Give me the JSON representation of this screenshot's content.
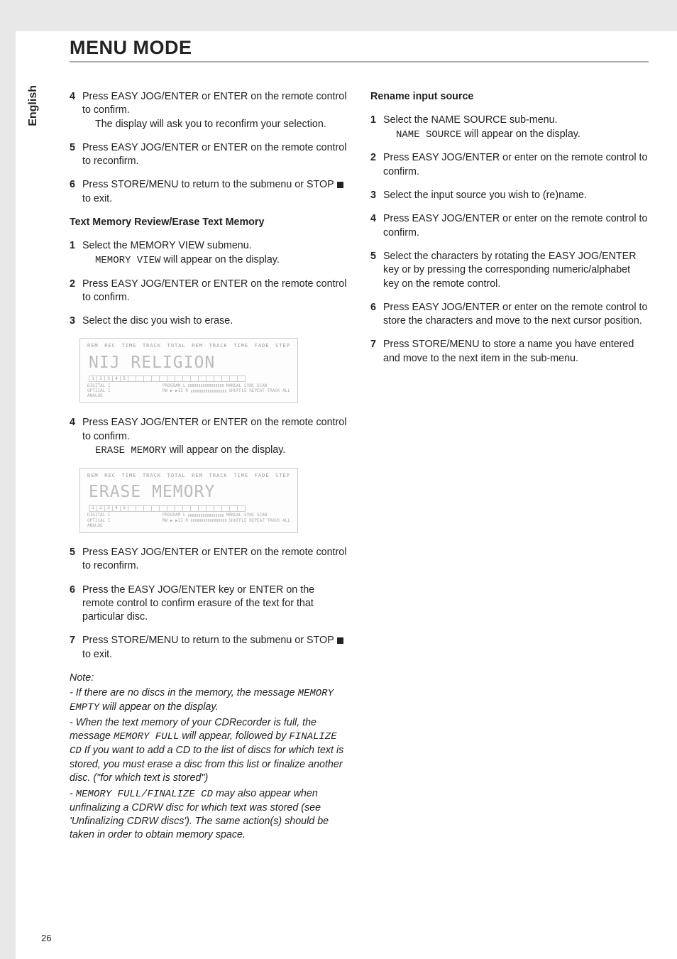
{
  "title": "MENU MODE",
  "language_tab": "English",
  "page_number": "26",
  "left": {
    "s4a": "Press EASY JOG/ENTER or ENTER on the remote control to confirm.",
    "s4b": "The display will ask you to reconfirm your selection.",
    "s5": "Press EASY JOG/ENTER or ENTER on the remote control to reconfirm.",
    "s6a": "Press STORE/MENU to return to the submenu or STOP",
    "s6b": "to exit.",
    "h1": "Text Memory Review/Erase Text Memory",
    "t1a": "Select the MEMORY VIEW submenu.",
    "t1_seg": "MEMORY VIEW",
    "t1b": " will appear on the display.",
    "t2": "Press EASY JOG/ENTER or ENTER on the remote control to confirm.",
    "t3": "Select the disc you wish to erase.",
    "disp1": {
      "top": [
        "REM",
        "REC",
        "TIME",
        "TRACK",
        "",
        "TOTAL",
        "REM",
        "TRACK",
        "TIME",
        "FADE",
        "",
        "STEP"
      ],
      "tnum": "",
      "txt": "NIJ  RELIGION",
      "tracks": [
        "1",
        "2",
        "3",
        "4",
        "5",
        "",
        "",
        "",
        "",
        "",
        "",
        "",
        "",
        "",
        "",
        "",
        "",
        "",
        "",
        ""
      ],
      "botL1": "DIGITAL I",
      "botL2": "OPTICAL I",
      "botL3": "ANALOG",
      "botM": "PROGRAM  L",
      "botR": "MANUAL SYNC   SCAN",
      "botR2": "SHUFFLE REPEAT TRACK ALL",
      "botIcon": "RW ▶ ▶II R"
    },
    "t4a": "Press EASY JOG/ENTER or ENTER on the remote control to confirm.",
    "t4_seg": "ERASE MEMORY",
    "t4b": " will appear on the display.",
    "disp2": {
      "top": [
        "REM",
        "REC",
        "TIME",
        "TRACK",
        "",
        "TOTAL",
        "REM",
        "TRACK",
        "TIME",
        "FADE",
        "",
        "STEP"
      ],
      "tnum": "",
      "txt": "ERASE  MEMORY",
      "tracks": [
        "1",
        "2",
        "3",
        "4",
        "5",
        "",
        "",
        "",
        "",
        "",
        "",
        "",
        "",
        "",
        "",
        "",
        "",
        "",
        "",
        ""
      ],
      "botL1": "DIGITAL I",
      "botL2": "OPTICAL I",
      "botL3": "ANALOG",
      "botM": "PROGRAM  L",
      "botR": "MANUAL SYNC   SCAN",
      "botR2": "SHUFFLE REPEAT TRACK ALL",
      "botIcon": "RW ▶ ▶II R"
    },
    "t5": "Press EASY JOG/ENTER or ENTER on the remote control to reconfirm.",
    "t6": "Press the EASY JOG/ENTER key or ENTER on the remote control to confirm erasure of the text for that particular disc.",
    "t7a": "Press STORE/MENU to return to the submenu or STOP",
    "t7b": "to exit.",
    "note_label": "Note:",
    "n1a": "- If there are no discs in the memory, the message ",
    "n1_seg": "MEMORY EMPTY",
    "n1b": " will appear on the display.",
    "n2a": "- When the text memory of your CDRecorder is full, the message ",
    "n2_seg1": "MEMORY FULL",
    "n2b": "  will appear, followed by ",
    "n2_seg2": "FINALIZE CD",
    "n2c": " If you want to add a CD to the list of discs for which text is stored, you must erase a disc from this list or finalize another disc. (\"for which text is stored\")",
    "n3a": "- ",
    "n3_seg": "MEMORY FULL/FINALIZE CD",
    "n3b": " may also appear when unfinalizing a CDRW disc for which text was stored (see 'Unfinalizing CDRW discs'). The same action(s)  should be taken in order to obtain memory space."
  },
  "right": {
    "h1": "Rename input source",
    "r1a": "Select the NAME SOURCE sub-menu.",
    "r1_seg": "NAME SOURCE",
    "r1b": " will appear on the display.",
    "r2": "Press EASY JOG/ENTER or enter on the remote control to confirm.",
    "r3": "Select the input source you wish to (re)name.",
    "r4": "Press EASY JOG/ENTER or enter on the remote control to confirm.",
    "r5": "Select the characters by rotating the EASY JOG/ENTER key or by pressing the corresponding numeric/alphabet key on the remote control.",
    "r6": "Press EASY JOG/ENTER or enter on the remote control to store the characters and move to the next cursor position.",
    "r7": "Press STORE/MENU to store a name you have entered and move to the next item in the sub-menu."
  }
}
